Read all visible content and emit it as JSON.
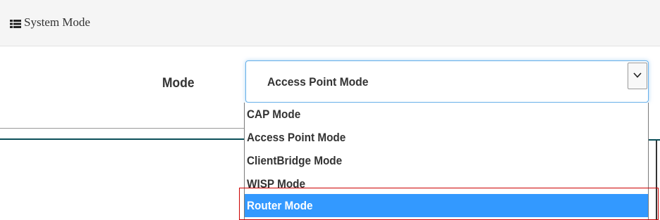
{
  "header": {
    "icon": "list-icon",
    "title": "System Mode"
  },
  "mode": {
    "label": "Mode",
    "selected_value": "Access Point Mode",
    "arrow_icon": "chevron-down-icon"
  },
  "dropdown": {
    "options": [
      "CAP Mode",
      "Access Point Mode",
      "ClientBridge Mode",
      "WISP Mode",
      "Router Mode"
    ],
    "highlighted_option": "Router Mode"
  },
  "colors": {
    "selection": "#3399ff",
    "focus_border": "#66afe9",
    "callout": "#cc0000"
  }
}
